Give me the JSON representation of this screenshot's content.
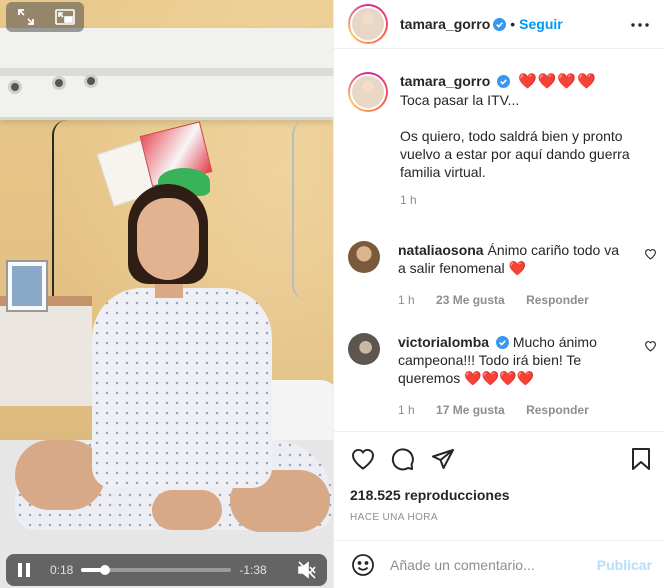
{
  "post": {
    "author": "tamara_gorro",
    "follow_label": "Seguir",
    "dot": "•",
    "caption_hearts": "❤️❤️❤️❤️",
    "caption_text": "Toca pasar la ITV...\n\nOs quiero, todo saldrá bien y pronto vuelvo a estar por aquí dando guerra familia virtual.",
    "caption_time": "1 h",
    "views": "218.525 reproducciones",
    "posted_ago": "HACE UNA HORA"
  },
  "comments": [
    {
      "user": "nataliaosona",
      "text": "Ánimo cariño todo va a salir fenomenal ❤️",
      "time": "1 h",
      "likes": "23 Me gusta",
      "reply": "Responder"
    },
    {
      "user": "victorialomba",
      "text": "Mucho ánimo campeona!!! Todo irá bien! Te queremos ❤️❤️❤️❤️",
      "time": "1 h",
      "likes": "17 Me gusta",
      "reply": "Responder"
    }
  ],
  "video": {
    "current_time": "0:18",
    "remaining_time": "-1:38",
    "progress_fraction": 0.155
  },
  "add_comment": {
    "placeholder": "Añade un comentario...",
    "publish_label": "Publicar"
  },
  "colors": {
    "accent": "#0095f6",
    "heart": "#ed4956",
    "publish_disabled": "#b2dffc"
  },
  "icons": {
    "video_expand": "expand-arrows-icon",
    "video_pip": "picture-in-picture-icon",
    "pause": "pause-icon",
    "mute": "speaker-muted-icon",
    "more": "more-options-icon",
    "like": "heart-icon",
    "comment": "comment-bubble-icon",
    "share": "paper-plane-icon",
    "save": "bookmark-icon",
    "emoji": "smiley-icon",
    "verified": "verified-badge-icon"
  }
}
